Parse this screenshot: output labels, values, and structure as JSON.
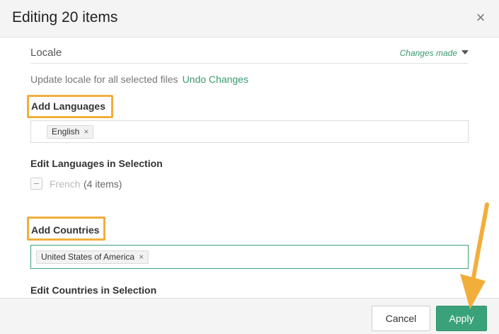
{
  "dialog": {
    "title": "Editing 20 items",
    "close_glyph": "×"
  },
  "locale": {
    "label": "Locale",
    "status": "Changes made"
  },
  "update": {
    "text": "Update locale for all selected files",
    "undo": "Undo Changes"
  },
  "languages": {
    "add_heading": "Add Languages",
    "tags": [
      {
        "label": "English"
      }
    ],
    "edit_heading": "Edit Languages in Selection",
    "items": [
      {
        "name": "French",
        "count": "(4 items)"
      }
    ]
  },
  "countries": {
    "add_heading": "Add Countries",
    "tags": [
      {
        "label": "United States of America"
      }
    ],
    "edit_heading": "Edit Countries in Selection"
  },
  "tag_remove_glyph": "×",
  "footer": {
    "cancel": "Cancel",
    "apply": "Apply"
  },
  "colors": {
    "accent_green": "#3aa27a",
    "highlight": "#f2ae3b"
  }
}
